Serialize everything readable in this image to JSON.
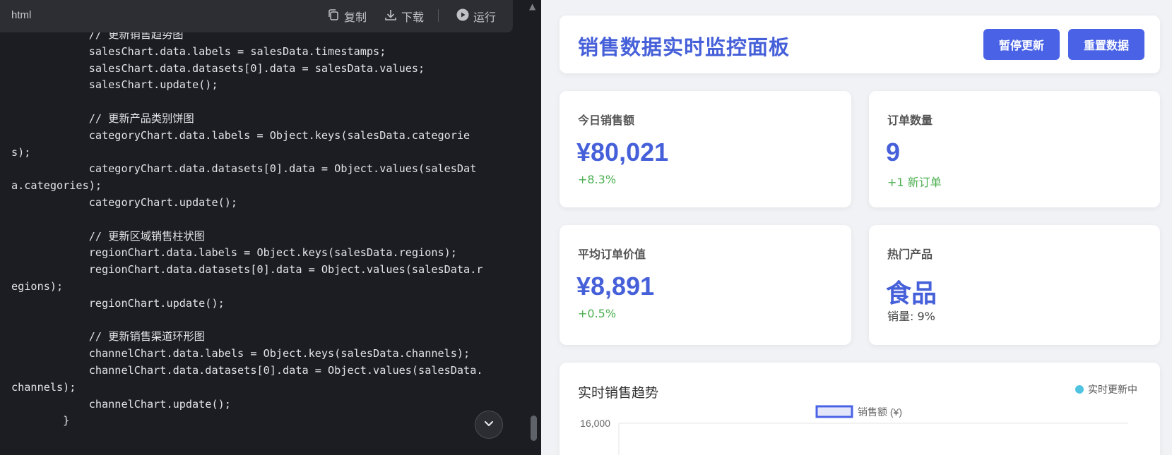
{
  "code_panel": {
    "language": "html",
    "toolbar": {
      "copy": "复制",
      "download": "下载",
      "run": "运行"
    },
    "lines": [
      "            // 更新销售趋势图",
      "            salesChart.data.labels = salesData.timestamps;",
      "            salesChart.data.datasets[0].data = salesData.values;",
      "            salesChart.update();",
      "",
      "            // 更新产品类别饼图",
      "            categoryChart.data.labels = Object.keys(salesData.categorie",
      "s);",
      "            categoryChart.data.datasets[0].data = Object.values(salesDat",
      "a.categories);",
      "            categoryChart.update();",
      "",
      "            // 更新区域销售柱状图",
      "            regionChart.data.labels = Object.keys(salesData.regions);",
      "            regionChart.data.datasets[0].data = Object.values(salesData.r",
      "egions);",
      "            regionChart.update();",
      "",
      "            // 更新销售渠道环形图",
      "            channelChart.data.labels = Object.keys(salesData.channels);",
      "            channelChart.data.datasets[0].data = Object.values(salesData.",
      "channels);",
      "            channelChart.update();",
      "        }"
    ]
  },
  "dashboard": {
    "title": "销售数据实时监控面板",
    "buttons": {
      "pause": "暂停更新",
      "reset": "重置数据"
    },
    "colors": {
      "accent": "#4660d9",
      "button": "#4a63e6",
      "positive": "#4caf50",
      "live": "#4fc3e0"
    },
    "stats": {
      "sales": {
        "label": "今日销售额",
        "value": "¥80,021",
        "sub": "+8.3%"
      },
      "orders": {
        "label": "订单数量",
        "value": "9",
        "sub": "+1 新订单"
      },
      "avg": {
        "label": "平均订单价值",
        "value": "¥8,891",
        "sub": "+0.5%"
      },
      "hot": {
        "label": "热门产品",
        "value": "食品",
        "sub": "销量: 9%"
      }
    },
    "trend": {
      "title": "实时销售趋势",
      "status": "实时更新中"
    }
  },
  "chart_data": {
    "type": "line",
    "title": "",
    "series": [
      {
        "name": "销售额 (¥)",
        "values": []
      }
    ],
    "y_ticks": [
      "16,000"
    ],
    "legend": "top-center",
    "grid": true
  }
}
